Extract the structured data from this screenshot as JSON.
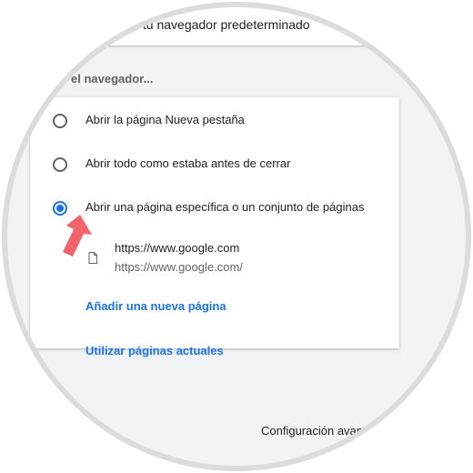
{
  "header": {
    "default_browser_text": "s tu navegador predeterminado"
  },
  "startup": {
    "section_title": "el navegador...",
    "options": [
      {
        "label": "Abrir la página Nueva pestaña",
        "selected": false
      },
      {
        "label": "Abrir todo como estaba antes de cerrar",
        "selected": false
      },
      {
        "label": "Abrir una página específica o un conjunto de páginas",
        "selected": true
      }
    ],
    "page_entry": {
      "title": "https://www.google.com",
      "url": "https://www.google.com/",
      "icon": "document-icon"
    },
    "add_page_label": "Añadir una nueva página",
    "use_current_label": "Utilizar páginas actuales"
  },
  "footer": {
    "advanced_label": "Configuración avan"
  },
  "colors": {
    "accent": "#1a73e8",
    "arrow": "#f0646a",
    "ring": "#d9d9d9"
  }
}
